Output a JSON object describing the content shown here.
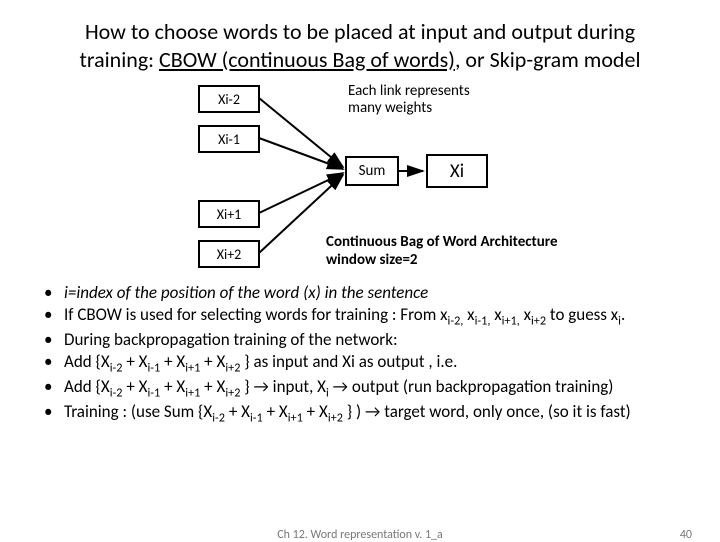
{
  "title": {
    "line1_pre": "How to choose words to be placed at input and output during",
    "line2_pre": "training: ",
    "line2_underline": "CBOW (continuous Bag of words)",
    "line2_post": ", or Skip-gram model"
  },
  "diagram": {
    "boxes": [
      "Xi-2",
      "Xi-1",
      "Xi+1",
      "Xi+2"
    ],
    "sum": "Sum",
    "out": "Xi",
    "note_line1": "Each link represents",
    "note_line2": "many weights",
    "arch_line1": "Continuous Bag of Word Architecture",
    "arch_line2": "window size=2"
  },
  "bullets": {
    "b1": "i=index of the position of the word (x) in the sentence",
    "b2a": "If CBOW is used for selecting words for training : From x",
    "b2b": " to guess x",
    "b2c": ".",
    "b3": "During backpropagation training of the network:",
    "b4a": "Add {X",
    "b4b": " } as input and Xi as output , i.e.",
    "b5a": "Add {X",
    "b5b": " } → input, X",
    "b5c": " → output (run backpropagation training)",
    "b6a": "Training : (use Sum {X",
    "b6b": " } ) → target word, only once, (so it is fast)"
  },
  "subs": {
    "im2": "i-2",
    "im1": "i-1",
    "ip1": "i+1",
    "ip2": "i+2",
    "i": "i",
    "im2c": "i-2,",
    "im1c": "i-1,",
    "ip1c": "i+1,"
  },
  "plus": " + X",
  "comma_x": " x",
  "footer": {
    "center": "Ch 12. Word representation v. 1_a",
    "right": "40"
  },
  "chart_data": {
    "type": "diagram",
    "inputs": [
      "Xi-2",
      "Xi-1",
      "Xi+1",
      "Xi+2"
    ],
    "aggregate": "Sum",
    "output": "Xi",
    "window_size": 2,
    "architecture": "Continuous Bag of Words (CBOW)"
  }
}
